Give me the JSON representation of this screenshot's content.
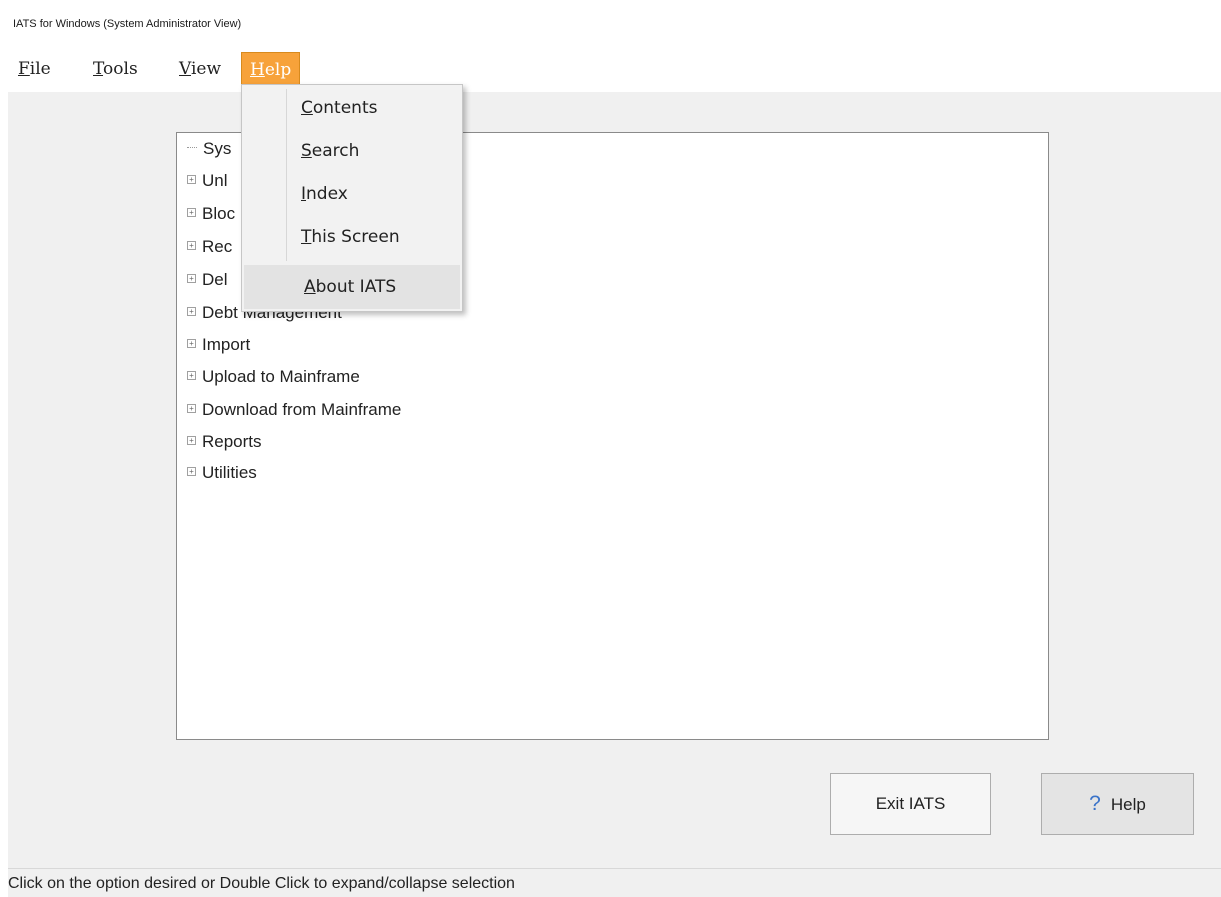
{
  "window": {
    "title": "IATS for Windows (System Administrator View)"
  },
  "menubar": {
    "items": [
      {
        "label": "File",
        "accel": "F",
        "rest": "ile"
      },
      {
        "label": "Tools",
        "accel": "T",
        "rest": "ools"
      },
      {
        "label": "View",
        "accel": "V",
        "rest": "iew"
      },
      {
        "label": "Help",
        "accel": "H",
        "rest": "elp"
      }
    ]
  },
  "help_menu": {
    "items": [
      {
        "label": "Contents",
        "accel": "C",
        "rest": "ontents"
      },
      {
        "label": "Search",
        "accel": "S",
        "rest": "earch"
      },
      {
        "label": "Index",
        "accel": "I",
        "rest": "ndex"
      },
      {
        "label": "This Screen",
        "accel": "T",
        "rest": "his Screen"
      },
      {
        "label": "About IATS",
        "accel": "A",
        "rest": "bout IATS"
      }
    ]
  },
  "tree": {
    "items": [
      {
        "label": "Sys",
        "expandable": false
      },
      {
        "label": "Unl",
        "expandable": true
      },
      {
        "label": "Bloc",
        "expandable": true
      },
      {
        "label": "Rec",
        "expandable": true
      },
      {
        "label": "Del",
        "expandable": true
      },
      {
        "label": "Debt Management",
        "expandable": true
      },
      {
        "label": "Import",
        "expandable": true
      },
      {
        "label": "Upload to Mainframe",
        "expandable": true
      },
      {
        "label": "Download from Mainframe",
        "expandable": true
      },
      {
        "label": "Reports",
        "expandable": true
      },
      {
        "label": "Utilities",
        "expandable": true
      }
    ]
  },
  "buttons": {
    "exit_label": "Exit IATS",
    "help_label": "Help",
    "help_icon": "?"
  },
  "status": {
    "text": "Click on the option desired or Double Click to expand/collapse selection"
  },
  "colors": {
    "menu_highlight": "#f7a23a",
    "help_icon": "#3a73c9"
  }
}
